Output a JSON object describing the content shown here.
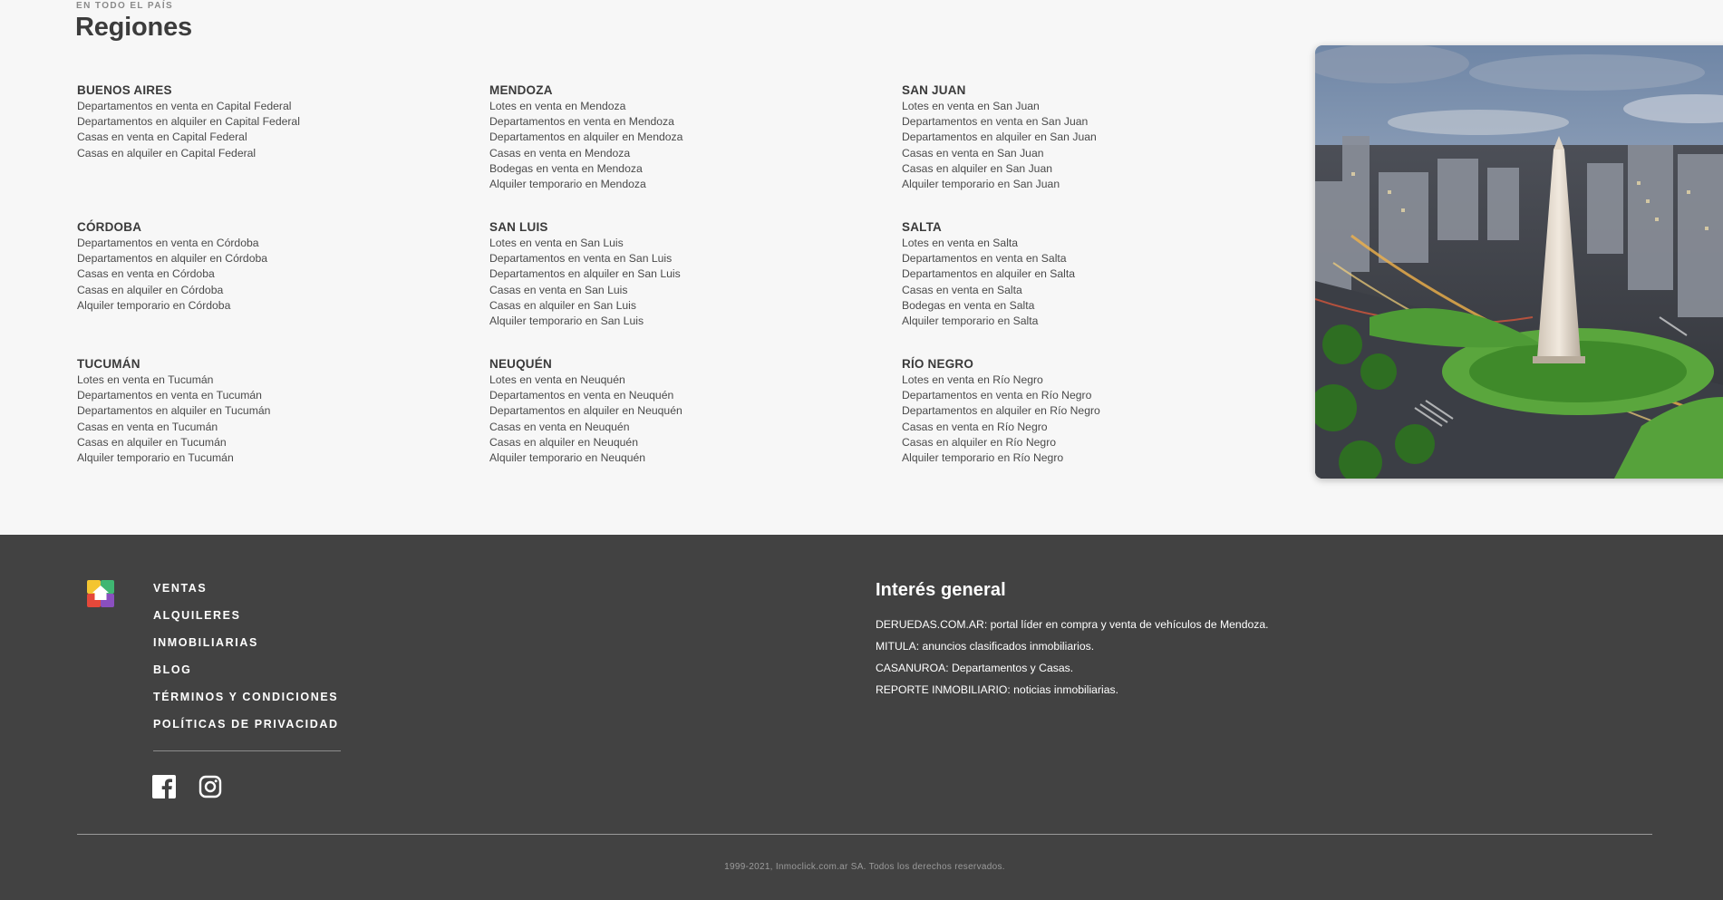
{
  "regions_section": {
    "eyebrow": "EN TODO EL PAÍS",
    "title": "Regiones",
    "regions": [
      {
        "name": "BUENOS AIRES",
        "links": [
          "Departamentos en venta en Capital Federal",
          "Departamentos en alquiler en Capital Federal",
          "Casas en venta en Capital Federal",
          "Casas en alquiler en Capital Federal"
        ]
      },
      {
        "name": "MENDOZA",
        "links": [
          "Lotes en venta en Mendoza",
          "Departamentos en venta en Mendoza",
          "Departamentos en alquiler en Mendoza",
          "Casas en venta en Mendoza",
          "Bodegas en venta en Mendoza",
          "Alquiler temporario en Mendoza"
        ]
      },
      {
        "name": "SAN JUAN",
        "links": [
          "Lotes en venta en San Juan",
          "Departamentos en venta en San Juan",
          "Departamentos en alquiler en San Juan",
          "Casas en venta en San Juan",
          "Casas en alquiler en San Juan",
          "Alquiler temporario en San Juan"
        ]
      },
      {
        "name": "CÓRDOBA",
        "links": [
          "Departamentos en venta en Córdoba",
          "Departamentos en alquiler en Córdoba",
          "Casas en venta en Córdoba",
          "Casas en alquiler en Córdoba",
          "Alquiler temporario en Córdoba"
        ]
      },
      {
        "name": "SAN LUIS",
        "links": [
          "Lotes en venta en San Luis",
          "Departamentos en venta en San Luis",
          "Departamentos en alquiler en San Luis",
          "Casas en venta en San Luis",
          "Casas en alquiler en San Luis",
          "Alquiler temporario en San Luis"
        ]
      },
      {
        "name": "SALTA",
        "links": [
          "Lotes en venta en Salta",
          "Departamentos en venta en Salta",
          "Departamentos en alquiler en Salta",
          "Casas en venta en Salta",
          "Bodegas en venta en Salta",
          "Alquiler temporario en Salta"
        ]
      },
      {
        "name": "TUCUMÁN",
        "links": [
          "Lotes en venta en Tucumán",
          "Departamentos en venta en Tucumán",
          "Departamentos en alquiler en Tucumán",
          "Casas en venta en Tucumán",
          "Casas en alquiler en Tucumán",
          "Alquiler temporario en Tucumán"
        ]
      },
      {
        "name": "NEUQUÉN",
        "links": [
          "Lotes en venta en Neuquén",
          "Departamentos en venta en Neuquén",
          "Departamentos en alquiler en Neuquén",
          "Casas en venta en Neuquén",
          "Casas en alquiler en Neuquén",
          "Alquiler temporario en Neuquén"
        ]
      },
      {
        "name": "RÍO NEGRO",
        "links": [
          "Lotes en venta en Río Negro",
          "Departamentos en venta en Río Negro",
          "Departamentos en alquiler en Río Negro",
          "Casas en venta en Río Negro",
          "Casas en alquiler en Río Negro",
          "Alquiler temporario en Río Negro"
        ]
      }
    ]
  },
  "footer": {
    "nav": [
      "VENTAS",
      "ALQUILERES",
      "INMOBILIARIAS",
      "BLOG",
      "TÉRMINOS Y CONDICIONES",
      "POLÍTICAS DE PRIVACIDAD"
    ],
    "social_icons": [
      "facebook-icon",
      "instagram-icon"
    ],
    "interest": {
      "title": "Interés general",
      "links": [
        "DERUEDAS.COM.AR: portal líder en compra y venta de vehículos de Mendoza.",
        "MITULA: anuncios clasificados inmobiliarios.",
        "CASANUROA: Departamentos y Casas.",
        "REPORTE INMOBILIARIO: noticias inmobiliarias."
      ]
    },
    "copyright": "1999-2021, Inmoclick.com.ar SA. Todos los derechos reservados."
  },
  "colors": {
    "page_bg": "#f7f7f7",
    "footer_bg": "#424242",
    "heading": "#3c3c3c",
    "link": "#4a4a4a",
    "footer_text": "#ffffff"
  }
}
